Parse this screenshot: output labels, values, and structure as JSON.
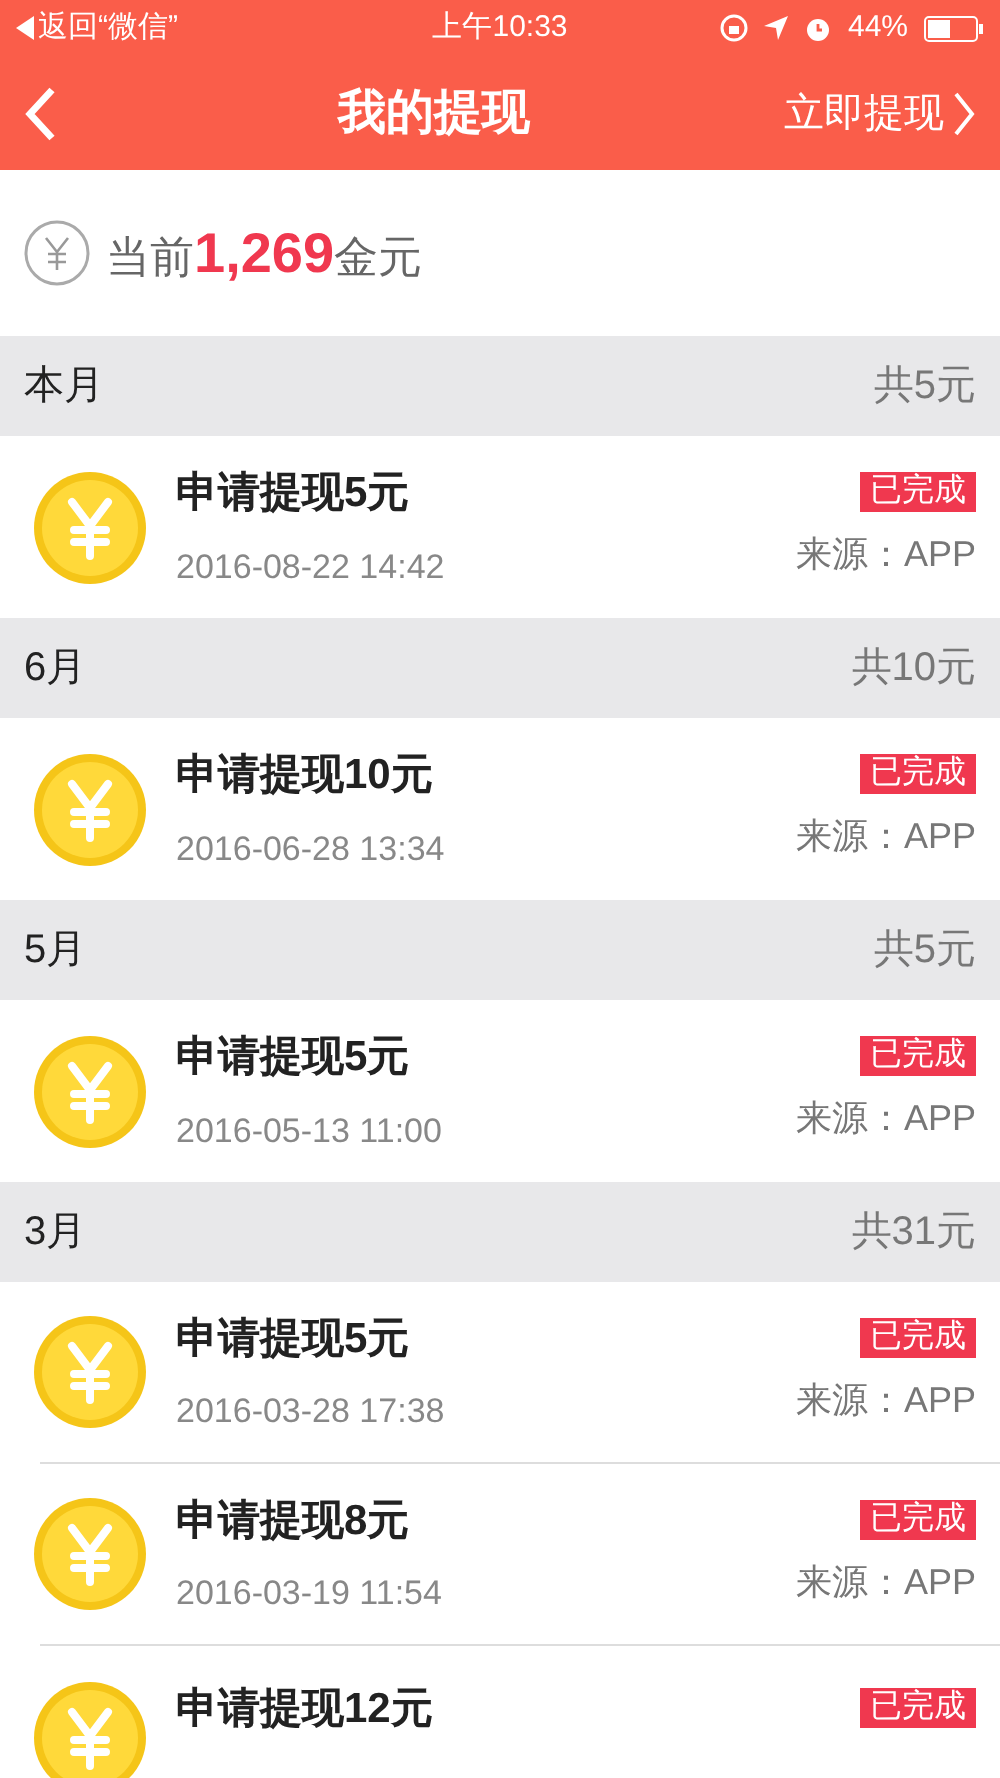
{
  "status_bar": {
    "back_label": "返回“微信”",
    "time": "上午10:33",
    "battery": "44%"
  },
  "nav": {
    "title": "我的提现",
    "action": "立即提现"
  },
  "balance": {
    "prefix": "当前",
    "amount": "1,269",
    "unit": "金元"
  },
  "sections": [
    {
      "title": "本月",
      "total": "共5元",
      "items": [
        {
          "title": "申请提现5元",
          "time": "2016-08-22 14:42",
          "status": "已完成",
          "source": "来源：APP"
        }
      ]
    },
    {
      "title": "6月",
      "total": "共10元",
      "items": [
        {
          "title": "申请提现10元",
          "time": "2016-06-28 13:34",
          "status": "已完成",
          "source": "来源：APP"
        }
      ]
    },
    {
      "title": "5月",
      "total": "共5元",
      "items": [
        {
          "title": "申请提现5元",
          "time": "2016-05-13 11:00",
          "status": "已完成",
          "source": "来源：APP"
        }
      ]
    },
    {
      "title": "3月",
      "total": "共31元",
      "items": [
        {
          "title": "申请提现5元",
          "time": "2016-03-28 17:38",
          "status": "已完成",
          "source": "来源：APP"
        },
        {
          "title": "申请提现8元",
          "time": "2016-03-19 11:54",
          "status": "已完成",
          "source": "来源：APP"
        },
        {
          "title": "申请提现12元",
          "status": "已完成"
        }
      ]
    }
  ]
}
